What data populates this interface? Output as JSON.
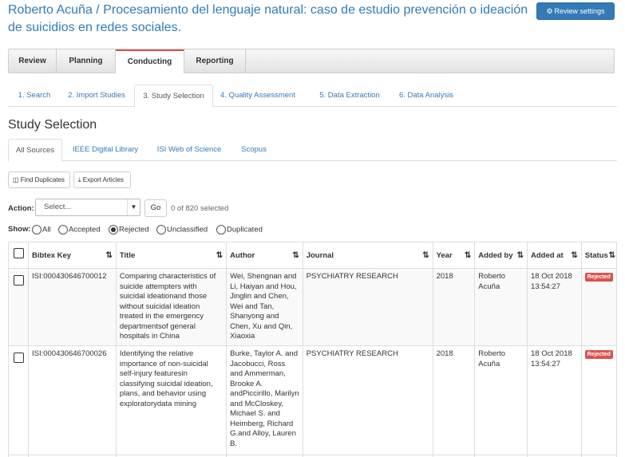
{
  "header": {
    "author": "Roberto Acuña",
    "separator": " / ",
    "project": "Procesamiento del lenguaje natural: caso de estudio prevención o ideación de suicidios en redes sociales.",
    "review_settings_label": "Review settings",
    "review_settings_icon": "gear-icon"
  },
  "phases": [
    "Review",
    "Planning",
    "Conducting",
    "Reporting"
  ],
  "phase_active": "Conducting",
  "subtabs": [
    "1. Search",
    "2. Import Studies",
    "3. Study Selection",
    "4. Quality Assessment",
    "5. Data Extraction",
    "6. Data Analysis"
  ],
  "subtab_active": "3. Study Selection",
  "page_title": "Study Selection",
  "source_tabs": [
    "All Sources",
    "IEEE Digital Library",
    "ISI Web of Science",
    "Scopus"
  ],
  "source_active": "All Sources",
  "toolbar": {
    "find_duplicates": "Find Duplicates",
    "export_articles": "Export Articles"
  },
  "action": {
    "label": "Action:",
    "select_value": "Select...",
    "go_label": "Go",
    "count_text": "0 of 820 selected"
  },
  "show": {
    "label": "Show:",
    "options": [
      "All",
      "Accepted",
      "Rejected",
      "Unclassified",
      "Duplicated"
    ],
    "selected": "Rejected"
  },
  "table": {
    "columns": [
      "Bibtex Key",
      "Title",
      "Author",
      "Journal",
      "Year",
      "Added by",
      "Added at",
      "Status"
    ],
    "sort_icon": "⇅",
    "rows": [
      {
        "key": "ISI:000430646700012",
        "title": "Comparing characteristics of suicide attempters with suicidal ideationand those without suicidal ideation treated in the emergency departmentsof general hospitals in China",
        "author": "Wei, Shengnan and Li, Haiyan and Hou, Jinglin and Chen, Wei and Tan, Shanyong and Chen, Xu and Qin, Xiaoxia",
        "journal": "PSYCHIATRY RESEARCH",
        "year": "2018",
        "added_by": "Roberto Acuña",
        "added_at": "18 Oct 2018 13:54:27",
        "status": "Rejected"
      },
      {
        "key": "ISI:000430646700026",
        "title": "Identifying the relative importance of non-suicidal self-injury featuresin classifying suicidal ideation, plans, and behavior using exploratorydata mining",
        "author": "Burke, Taylor A. and Jacobucci, Ross and Ammerman, Brooke A. andPiccirillo, Marilyn and McCloskey, Michael S. and Heimberg, Richard G.and Alloy, Lauren B.",
        "journal": "PSYCHIATRY RESEARCH",
        "year": "2018",
        "added_by": "Roberto Acuña",
        "added_at": "18 Oct 2018 13:54:27",
        "status": "Rejected"
      }
    ]
  },
  "colors": {
    "link": "#337ab7",
    "primary_button": "#337ab7",
    "rejected_badge": "#d9534f",
    "active_phase_border": "#d9534f"
  }
}
